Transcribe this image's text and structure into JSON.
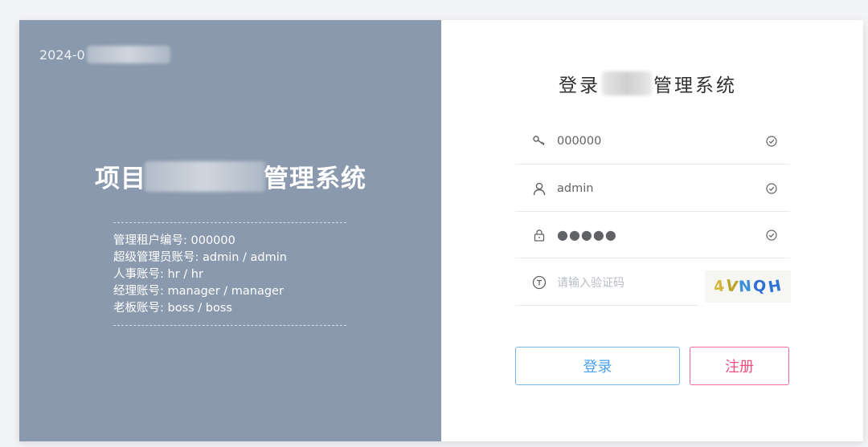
{
  "left_panel": {
    "date_prefix": "2024-0",
    "system_title_prefix": "项目",
    "system_title_suffix": "管理系统",
    "accounts": [
      "管理租户编号: 000000",
      "超级管理员账号: admin / admin",
      "人事账号: hr / hr",
      "经理账号: manager / manager",
      "老板账号: boss / boss"
    ]
  },
  "login_form": {
    "title_prefix": "登录",
    "title_suffix": "管理系统",
    "tenant_value": "000000",
    "username_value": "admin",
    "password_value": "●●●●●",
    "captcha_placeholder": "请输入验证码",
    "captcha_chars": [
      "4",
      "V",
      "N",
      "Q",
      "H"
    ],
    "captcha_colors": [
      "#d6b63a",
      "#b9a42a",
      "#3b8fd8",
      "#2f6fd0",
      "#2f73d8"
    ],
    "login_button": "登录",
    "register_button": "注册"
  },
  "colors": {
    "left_panel_bg": "#8a99ad",
    "login_accent": "#4aa1ee",
    "register_accent": "#ee4f7f"
  }
}
